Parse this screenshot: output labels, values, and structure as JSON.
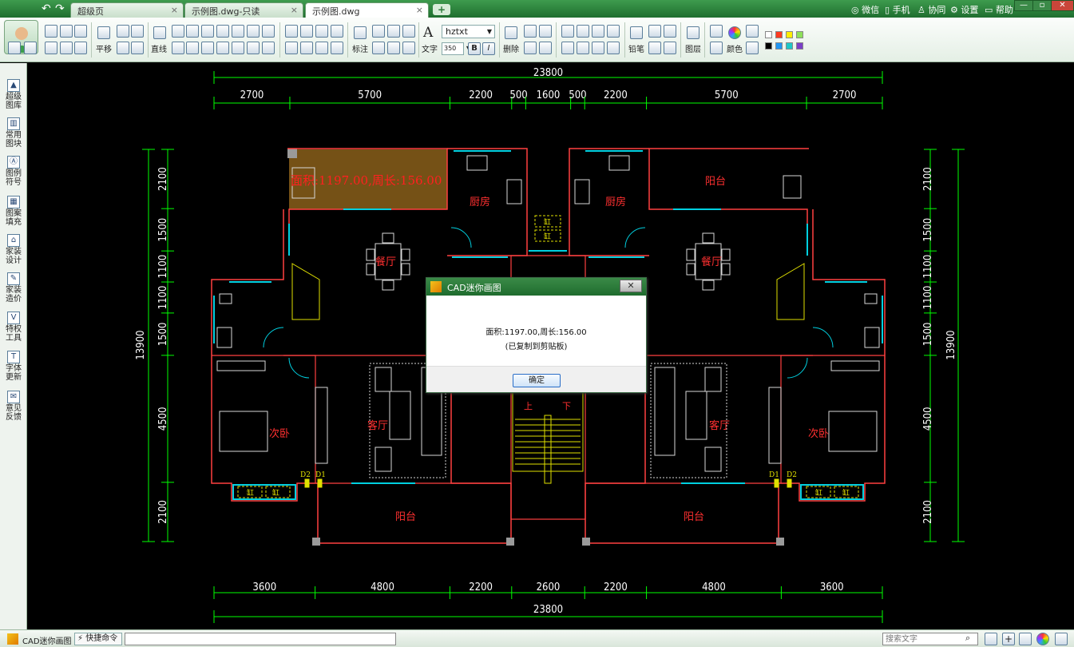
{
  "title_bar": {
    "tabs": [
      {
        "label": "超级页",
        "close": "×"
      },
      {
        "label": "示例图.dwg-只读",
        "close": "×"
      },
      {
        "label": "示例图.dwg",
        "close": "×"
      }
    ],
    "add_tab": "+",
    "links": [
      "微信",
      "手机",
      "协同",
      "设置",
      "帮助"
    ],
    "window_buttons": [
      "—",
      "▫",
      "✕"
    ]
  },
  "toolbar": {
    "labels": {
      "pan": "平移",
      "line": "直线",
      "dimension": "标注",
      "text": "文字",
      "delete": "删除",
      "pencil": "铅笔",
      "layer": "图层",
      "color": "颜色"
    },
    "font_name": "hztxt",
    "font_size": "350",
    "bold": "B",
    "italic": "I",
    "swatch_colors": [
      "#ffffff",
      "#ff3b1f",
      "#ffee00",
      "#8ee05a",
      "#000000",
      "#2196f3",
      "#1ec7c7",
      "#7a3fc7"
    ]
  },
  "left_sidebar": {
    "items": [
      {
        "label1": "超级",
        "label2": "图库"
      },
      {
        "label1": "常用",
        "label2": "图块"
      },
      {
        "label1": "图例",
        "label2": "符号"
      },
      {
        "label1": "图案",
        "label2": "填充"
      },
      {
        "label1": "家装",
        "label2": "设计"
      },
      {
        "label1": "家装",
        "label2": "造价"
      },
      {
        "label1": "特权",
        "label2": "工具"
      },
      {
        "label1": "字体",
        "label2": "更新"
      },
      {
        "label1": "意见",
        "label2": "反馈"
      }
    ]
  },
  "drawing": {
    "top_total": "23800",
    "top_dims": [
      "2700",
      "5700",
      "2200",
      "500",
      "1600",
      "500",
      "2200",
      "5700",
      "2700"
    ],
    "bottom_dims": [
      "3600",
      "4800",
      "2200",
      "2600",
      "2200",
      "4800",
      "3600"
    ],
    "bottom_total": "23800",
    "left_dims": [
      "2100",
      "1500",
      "1100",
      "1100",
      "1500",
      "4500",
      "2100"
    ],
    "right_dims": [
      "2100",
      "1500",
      "1100",
      "1100",
      "1500",
      "4500",
      "2100"
    ],
    "side_total": "13900",
    "area_text": "面积:1197.00,周长:156.00",
    "rooms": {
      "kitchen": "厨房",
      "dining": "餐厅",
      "balcony": "阳台",
      "secondary_bedroom": "次卧",
      "living": "客厅",
      "vat": "缸",
      "up": "上",
      "down": "下",
      "d1": "D1",
      "d2": "D2"
    },
    "colors": {
      "dim": "#00ff00",
      "wall": "#ff4040",
      "room_text": "#ff3030",
      "window": "#00d0e0",
      "furniture": "#d8d8d8",
      "stair": "#e0e000",
      "highlight": "#b8862a"
    }
  },
  "dialog": {
    "title": "CAD迷你画图",
    "close": "✕",
    "line1": "面积:1197.00,周长:156.00",
    "line2": "(已复制到剪贴板)",
    "ok": "确定"
  },
  "status_bar": {
    "app_name": "CAD迷你画图",
    "quick_cmd": "快捷命令",
    "command_input": "",
    "search_placeholder": "搜索文字"
  }
}
